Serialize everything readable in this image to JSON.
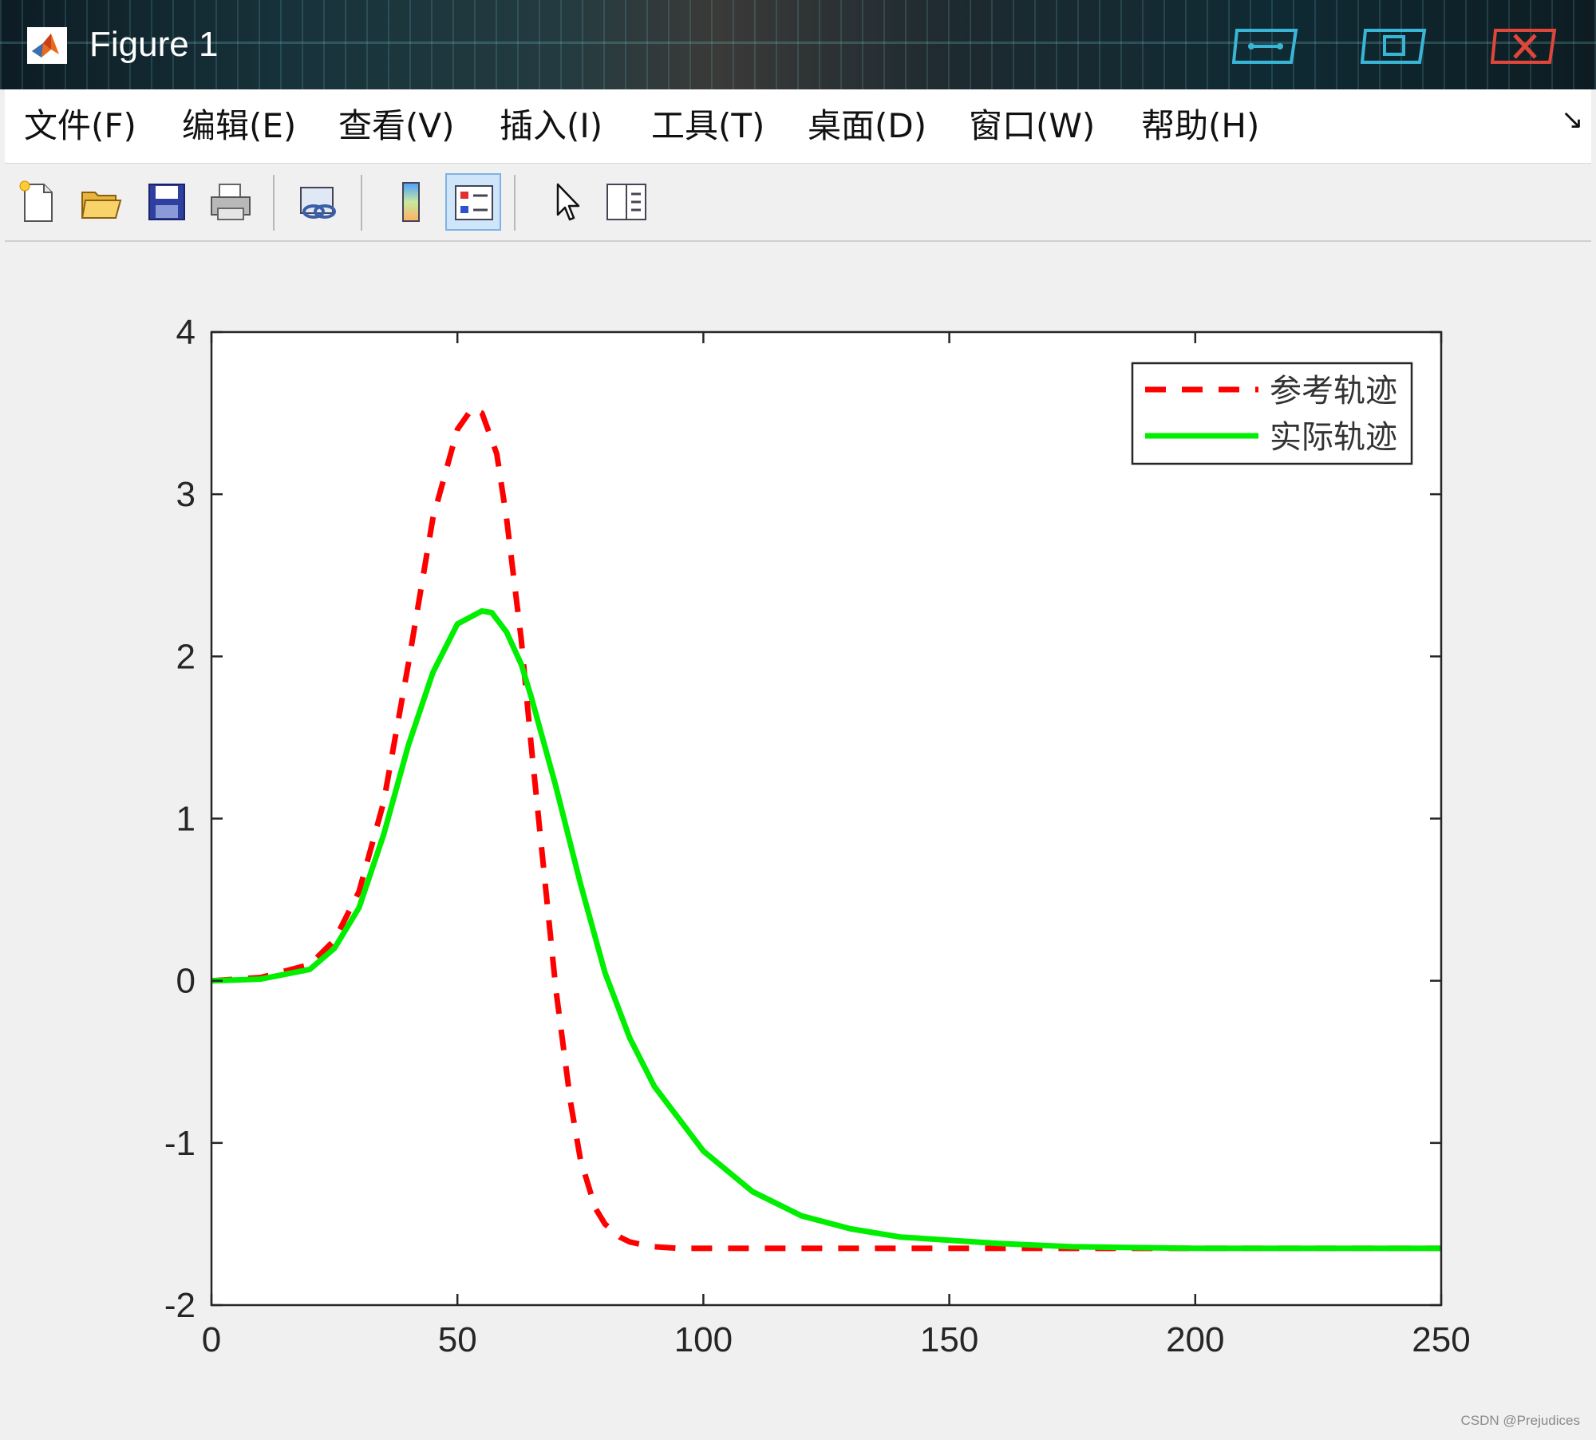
{
  "window": {
    "title": "Figure 1",
    "app_icon": "matlab-icon",
    "controls": [
      "minimize-icon",
      "maximize-icon",
      "close-icon"
    ]
  },
  "menu": {
    "items": [
      "文件(F)",
      "编辑(E)",
      "查看(V)",
      "插入(I)",
      "工具(T)",
      "桌面(D)",
      "窗口(W)",
      "帮助(H)"
    ],
    "expand_icon": "dock-arrow-icon"
  },
  "toolbar": {
    "tools": [
      "new-figure-icon",
      "open-file-icon",
      "save-icon",
      "print-icon",
      "link-plot-icon",
      "colorbar-icon",
      "legend-icon",
      "pointer-icon",
      "property-inspector-icon"
    ],
    "pressed": "legend-icon"
  },
  "chart_data": {
    "type": "line",
    "title": "",
    "xlabel": "",
    "ylabel": "",
    "xlim": [
      0,
      250
    ],
    "ylim": [
      -2,
      4
    ],
    "x_ticks": [
      "0",
      "50",
      "100",
      "150",
      "200",
      "250"
    ],
    "y_ticks": [
      "-2",
      "-1",
      "0",
      "1",
      "2",
      "3",
      "4"
    ],
    "grid": false,
    "legend_position": "top-right",
    "series": [
      {
        "name": "参考轨迹",
        "color": "#ff0000",
        "style": "dashed",
        "x": [
          0,
          10,
          20,
          25,
          30,
          35,
          40,
          45,
          50,
          53,
          55,
          58,
          60,
          63,
          65,
          68,
          70,
          73,
          75,
          78,
          80,
          83,
          85,
          88,
          90,
          95,
          100,
          110,
          120,
          150,
          200,
          250
        ],
        "y": [
          0,
          0.02,
          0.1,
          0.25,
          0.55,
          1.1,
          1.95,
          2.85,
          3.4,
          3.53,
          3.5,
          3.25,
          2.85,
          2.1,
          1.45,
          0.55,
          -0.05,
          -0.75,
          -1.1,
          -1.4,
          -1.5,
          -1.58,
          -1.61,
          -1.63,
          -1.64,
          -1.65,
          -1.65,
          -1.65,
          -1.65,
          -1.65,
          -1.65,
          -1.65
        ]
      },
      {
        "name": "实际轨迹",
        "color": "#00ee00",
        "style": "solid",
        "x": [
          0,
          10,
          20,
          25,
          30,
          35,
          40,
          45,
          50,
          55,
          57,
          60,
          63,
          65,
          70,
          75,
          80,
          85,
          90,
          100,
          110,
          120,
          130,
          140,
          150,
          160,
          175,
          200,
          250
        ],
        "y": [
          0,
          0.01,
          0.07,
          0.2,
          0.45,
          0.9,
          1.45,
          1.9,
          2.2,
          2.28,
          2.27,
          2.15,
          1.95,
          1.75,
          1.2,
          0.6,
          0.05,
          -0.35,
          -0.65,
          -1.05,
          -1.3,
          -1.45,
          -1.53,
          -1.58,
          -1.6,
          -1.62,
          -1.64,
          -1.65,
          -1.65
        ]
      }
    ]
  },
  "watermark": "CSDN @Prejudices"
}
